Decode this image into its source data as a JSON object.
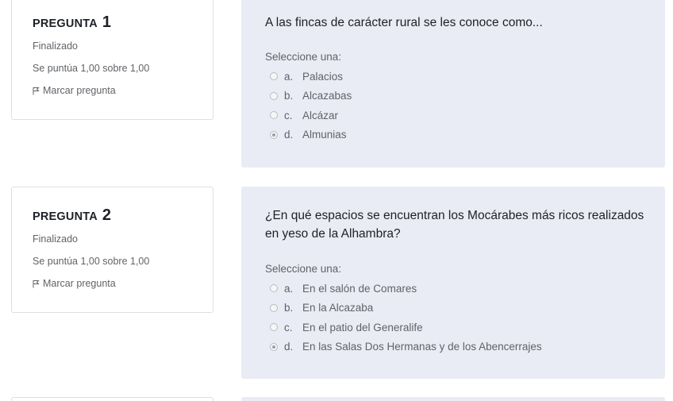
{
  "questions": [
    {
      "word": "PREGUNTA",
      "number": "1",
      "status": "Finalizado",
      "score": "Se puntúa 1,00 sobre 1,00",
      "flag_label": "Marcar pregunta",
      "text": "A las fincas de carácter rural se les conoce como...",
      "prompt": "Seleccione una:",
      "answers": [
        {
          "letter": "a.",
          "text": "Palacios",
          "selected": false
        },
        {
          "letter": "b.",
          "text": "Alcazabas",
          "selected": false
        },
        {
          "letter": "c.",
          "text": "Alcázar",
          "selected": false
        },
        {
          "letter": "d.",
          "text": "Almunias",
          "selected": true
        }
      ]
    },
    {
      "word": "PREGUNTA",
      "number": "2",
      "status": "Finalizado",
      "score": "Se puntúa 1,00 sobre 1,00",
      "flag_label": "Marcar pregunta",
      "text": "¿En qué espacios se encuentran los Mocárabes más ricos realizados en yeso de la Alhambra?",
      "prompt": "Seleccione una:",
      "answers": [
        {
          "letter": "a.",
          "text": "En el salón de Comares",
          "selected": false
        },
        {
          "letter": "b.",
          "text": "En la Alcazaba",
          "selected": false
        },
        {
          "letter": "c.",
          "text": "En el patio del Generalife",
          "selected": false
        },
        {
          "letter": "d.",
          "text": "En las Salas Dos Hermanas y de los Abencerrajes",
          "selected": true
        }
      ]
    }
  ]
}
